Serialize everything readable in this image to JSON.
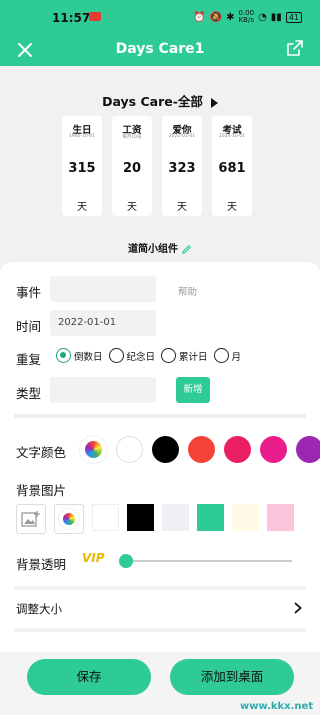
{
  "status_bar": {
    "time": "11:57",
    "net_speed_value": "0.00",
    "net_speed_unit": "KB/s",
    "battery": "41"
  },
  "header": {
    "title": "Days Care1"
  },
  "preview": {
    "widget_title": "Days Care-全部",
    "cards": [
      {
        "label": "生日",
        "date": "1940-10-01",
        "days": "315",
        "unit": "天"
      },
      {
        "label": "工资",
        "date": "每月10号",
        "days": "20",
        "unit": "天"
      },
      {
        "label": "爱你",
        "date": "2022-01-01",
        "days": "323",
        "unit": "天"
      },
      {
        "label": "考试",
        "date": "2024-10-01",
        "days": "681",
        "unit": "天"
      }
    ],
    "widget_name": "道简小组件"
  },
  "form": {
    "event_label": "事件",
    "event_value": "",
    "help": "帮助",
    "time_label": "时间",
    "time_value": "2022-01-01",
    "repeat_label": "重复",
    "repeat_options": [
      "倒数日",
      "纪念日",
      "累计日",
      "月"
    ],
    "repeat_selected": "倒数日",
    "type_label": "类型",
    "type_value": "",
    "add_button": "新增",
    "text_color_label": "文字颜色",
    "text_colors": [
      "#ffffff",
      "#000000",
      "#f44336",
      "#e91e63",
      "#e91e8c",
      "#9c27b0"
    ],
    "bg_image_label": "背景图片",
    "bg_colors": [
      "#ffffff",
      "#000000",
      "#eef0f4",
      "#2fcb94",
      "#fffbe6",
      "#fbc4dc"
    ],
    "bg_opacity_label": "背景透明",
    "vip": "VIP",
    "opacity_level": 0,
    "resize_label": "调整大小"
  },
  "actions": {
    "save": "保存",
    "add_to_home": "添加到桌面"
  },
  "watermark": "www.kkx.net",
  "colors": {
    "accent": "#2fcb94"
  }
}
